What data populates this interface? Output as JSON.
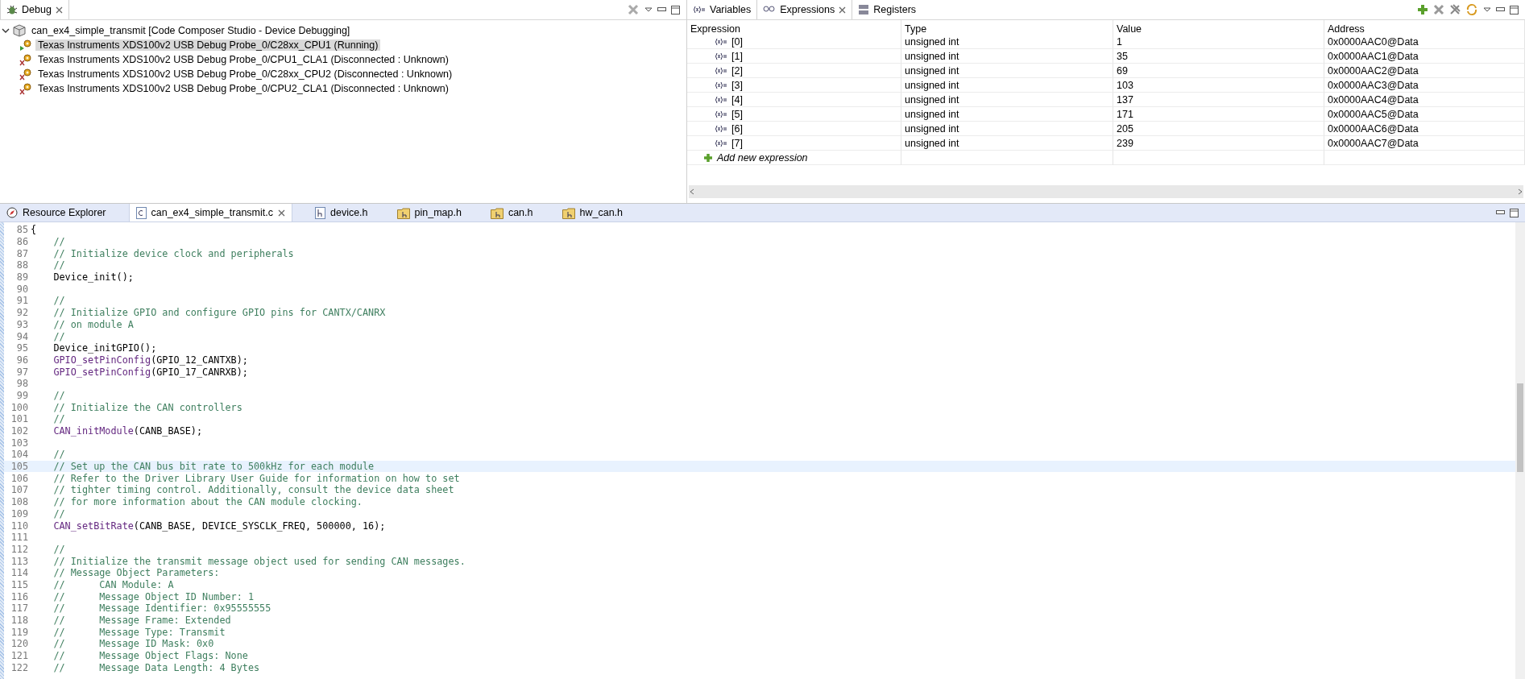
{
  "debug_view": {
    "title": "Debug",
    "root": {
      "label": "can_ex4_simple_transmit [Code Composer Studio - Device Debugging]",
      "expanded": true,
      "children": [
        {
          "label": "Texas Instruments XDS100v2 USB Debug Probe_0/C28xx_CPU1 (Running)",
          "kind": "running",
          "selected": true
        },
        {
          "label": "Texas Instruments XDS100v2 USB Debug Probe_0/CPU1_CLA1 (Disconnected : Unknown)",
          "kind": "disconnected",
          "selected": false
        },
        {
          "label": "Texas Instruments XDS100v2 USB Debug Probe_0/C28xx_CPU2 (Disconnected : Unknown)",
          "kind": "disconnected",
          "selected": false
        },
        {
          "label": "Texas Instruments XDS100v2 USB Debug Probe_0/CPU2_CLA1 (Disconnected : Unknown)",
          "kind": "disconnected",
          "selected": false
        }
      ]
    }
  },
  "expressions_view": {
    "tabs": [
      {
        "label": "Variables",
        "kind": "variables",
        "selected": false,
        "closable": false
      },
      {
        "label": "Expressions",
        "kind": "expressions",
        "selected": true,
        "closable": true
      },
      {
        "label": "Registers",
        "kind": "registers",
        "selected": false,
        "closable": false
      }
    ],
    "columns": [
      "Expression",
      "Type",
      "Value",
      "Address"
    ],
    "rows": [
      {
        "expression": "[0]",
        "type": "unsigned int",
        "value": "1",
        "address": "0x0000AAC0@Data"
      },
      {
        "expression": "[1]",
        "type": "unsigned int",
        "value": "35",
        "address": "0x0000AAC1@Data"
      },
      {
        "expression": "[2]",
        "type": "unsigned int",
        "value": "69",
        "address": "0x0000AAC2@Data"
      },
      {
        "expression": "[3]",
        "type": "unsigned int",
        "value": "103",
        "address": "0x0000AAC3@Data"
      },
      {
        "expression": "[4]",
        "type": "unsigned int",
        "value": "137",
        "address": "0x0000AAC4@Data"
      },
      {
        "expression": "[5]",
        "type": "unsigned int",
        "value": "171",
        "address": "0x0000AAC5@Data"
      },
      {
        "expression": "[6]",
        "type": "unsigned int",
        "value": "205",
        "address": "0x0000AAC6@Data"
      },
      {
        "expression": "[7]",
        "type": "unsigned int",
        "value": "239",
        "address": "0x0000AAC7@Data"
      }
    ],
    "add_label": "Add new expression"
  },
  "editor": {
    "tabs": [
      {
        "label": "Resource Explorer",
        "kind": "explorer",
        "selected": false,
        "closable": false
      },
      {
        "label": "can_ex4_simple_transmit.c",
        "kind": "c",
        "selected": true,
        "closable": true
      },
      {
        "label": "device.h",
        "kind": "h",
        "selected": false,
        "closable": false
      },
      {
        "label": "pin_map.h",
        "kind": "hlib",
        "selected": false,
        "closable": false
      },
      {
        "label": "can.h",
        "kind": "hlib",
        "selected": false,
        "closable": false
      },
      {
        "label": "hw_can.h",
        "kind": "hlib",
        "selected": false,
        "closable": false
      }
    ],
    "lines": [
      {
        "number": "85",
        "current": false,
        "tokens": [
          {
            "kind": "plain",
            "text": "{"
          }
        ]
      },
      {
        "number": "86",
        "current": false,
        "tokens": [
          {
            "kind": "comment",
            "text": "    //"
          }
        ]
      },
      {
        "number": "87",
        "current": false,
        "tokens": [
          {
            "kind": "comment",
            "text": "    // Initialize device clock and peripherals"
          }
        ]
      },
      {
        "number": "88",
        "current": false,
        "tokens": [
          {
            "kind": "comment",
            "text": "    //"
          }
        ]
      },
      {
        "number": "89",
        "current": false,
        "tokens": [
          {
            "kind": "plain",
            "text": "    Device_init();"
          }
        ]
      },
      {
        "number": "90",
        "current": false
      },
      {
        "number": "91",
        "current": false,
        "tokens": [
          {
            "kind": "comment",
            "text": "    //"
          }
        ]
      },
      {
        "number": "92",
        "current": false,
        "tokens": [
          {
            "kind": "comment",
            "text": "    // Initialize GPIO and configure GPIO pins for CANTX/CANRX"
          }
        ]
      },
      {
        "number": "93",
        "current": false,
        "tokens": [
          {
            "kind": "comment",
            "text": "    // on module A"
          }
        ]
      },
      {
        "number": "94",
        "current": false,
        "tokens": [
          {
            "kind": "comment",
            "text": "    //"
          }
        ]
      },
      {
        "number": "95",
        "current": false,
        "tokens": [
          {
            "kind": "plain",
            "text": "    Device_initGPIO();"
          }
        ]
      },
      {
        "number": "96",
        "current": false,
        "tokens": [
          {
            "kind": "function",
            "text": "    GPIO_setPinConfig"
          },
          {
            "kind": "plain",
            "text": "(GPIO_12_CANTXB);"
          }
        ]
      },
      {
        "number": "97",
        "current": false,
        "tokens": [
          {
            "kind": "function",
            "text": "    GPIO_setPinConfig"
          },
          {
            "kind": "plain",
            "text": "(GPIO_17_CANRXB);"
          }
        ]
      },
      {
        "number": "98",
        "current": false
      },
      {
        "number": "99",
        "current": false,
        "tokens": [
          {
            "kind": "comment",
            "text": "    //"
          }
        ]
      },
      {
        "number": "100",
        "current": false,
        "tokens": [
          {
            "kind": "comment",
            "text": "    // Initialize the CAN controllers"
          }
        ]
      },
      {
        "number": "101",
        "current": false,
        "tokens": [
          {
            "kind": "comment",
            "text": "    //"
          }
        ]
      },
      {
        "number": "102",
        "current": false,
        "tokens": [
          {
            "kind": "function",
            "text": "    CAN_initModule"
          },
          {
            "kind": "plain",
            "text": "(CANB_BASE);"
          }
        ]
      },
      {
        "number": "103",
        "current": false
      },
      {
        "number": "104",
        "current": false,
        "tokens": [
          {
            "kind": "comment",
            "text": "    //"
          }
        ]
      },
      {
        "number": "105",
        "current": true,
        "tokens": [
          {
            "kind": "comment",
            "text": "    // Set up the CAN bus bit rate to 500kHz for each module"
          }
        ]
      },
      {
        "number": "106",
        "current": false,
        "tokens": [
          {
            "kind": "comment",
            "text": "    // Refer to the Driver Library User Guide for information on how to set"
          }
        ]
      },
      {
        "number": "107",
        "current": false,
        "tokens": [
          {
            "kind": "comment",
            "text": "    // tighter timing control. Additionally, consult the device data sheet"
          }
        ]
      },
      {
        "number": "108",
        "current": false,
        "tokens": [
          {
            "kind": "comment",
            "text": "    // for more information about the CAN module clocking."
          }
        ]
      },
      {
        "number": "109",
        "current": false,
        "tokens": [
          {
            "kind": "comment",
            "text": "    //"
          }
        ]
      },
      {
        "number": "110",
        "current": false,
        "tokens": [
          {
            "kind": "function",
            "text": "    CAN_setBitRate"
          },
          {
            "kind": "plain",
            "text": "(CANB_BASE, DEVICE_SYSCLK_FREQ, 500000, 16);"
          }
        ]
      },
      {
        "number": "111",
        "current": false
      },
      {
        "number": "112",
        "current": false,
        "tokens": [
          {
            "kind": "comment",
            "text": "    //"
          }
        ]
      },
      {
        "number": "113",
        "current": false,
        "tokens": [
          {
            "kind": "comment",
            "text": "    // Initialize the transmit message object used for sending CAN messages."
          }
        ]
      },
      {
        "number": "114",
        "current": false,
        "tokens": [
          {
            "kind": "comment",
            "text": "    // Message Object Parameters:"
          }
        ]
      },
      {
        "number": "115",
        "current": false,
        "tokens": [
          {
            "kind": "comment",
            "text": "    //      CAN Module: A"
          }
        ]
      },
      {
        "number": "116",
        "current": false,
        "tokens": [
          {
            "kind": "comment",
            "text": "    //      Message Object ID Number: 1"
          }
        ]
      },
      {
        "number": "117",
        "current": false,
        "tokens": [
          {
            "kind": "comment",
            "text": "    //      Message Identifier: 0x95555555"
          }
        ]
      },
      {
        "number": "118",
        "current": false,
        "tokens": [
          {
            "kind": "comment",
            "text": "    //      Message Frame: Extended"
          }
        ]
      },
      {
        "number": "119",
        "current": false,
        "tokens": [
          {
            "kind": "comment",
            "text": "    //      Message Type: Transmit"
          }
        ]
      },
      {
        "number": "120",
        "current": false,
        "tokens": [
          {
            "kind": "comment",
            "text": "    //      Message ID Mask: 0x0"
          }
        ]
      },
      {
        "number": "121",
        "current": false,
        "tokens": [
          {
            "kind": "comment",
            "text": "    //      Message Object Flags: None"
          }
        ]
      },
      {
        "number": "122",
        "current": false,
        "tokens": [
          {
            "kind": "comment",
            "text": "    //      Message Data Length: 4 Bytes"
          }
        ]
      }
    ]
  }
}
